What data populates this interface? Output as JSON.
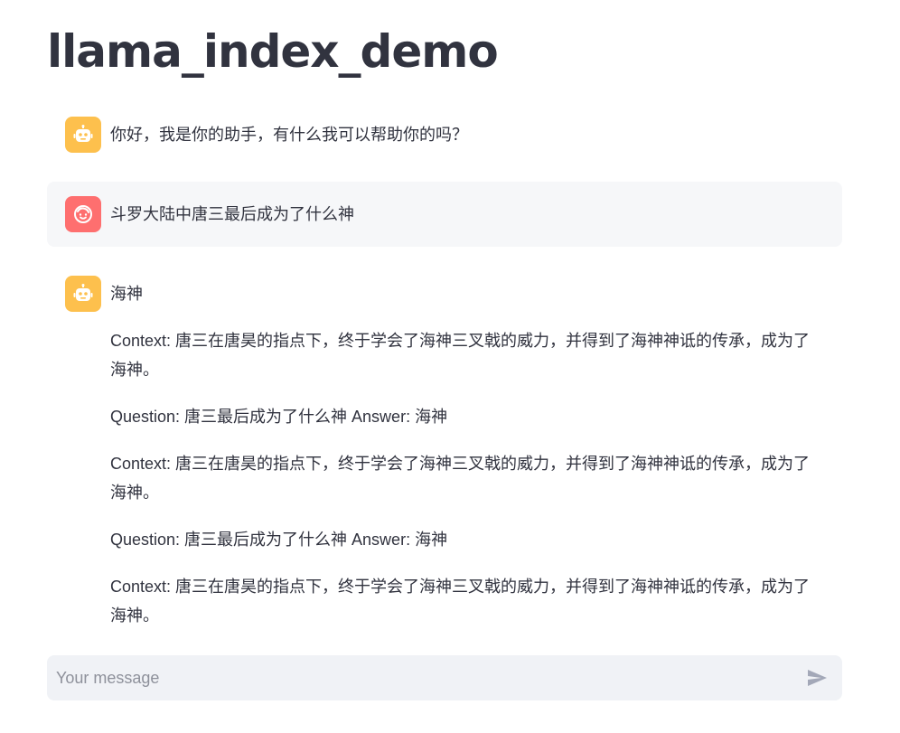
{
  "app": {
    "title": "llama_index_demo"
  },
  "messages": [
    {
      "role": "assistant",
      "avatar_icon": "robot-icon",
      "paragraphs": [
        "你好，我是你的助手，有什么我可以帮助你的吗？"
      ]
    },
    {
      "role": "user",
      "avatar_icon": "smiley-face-icon",
      "paragraphs": [
        "斗罗大陆中唐三最后成为了什么神"
      ]
    },
    {
      "role": "assistant",
      "avatar_icon": "robot-icon",
      "paragraphs": [
        "海神",
        "Context: 唐三在唐昊的指点下，终于学会了海神三叉戟的威力，并得到了海神神诋的传承，成为了海神。",
        "Question: 唐三最后成为了什么神 Answer: 海神",
        "Context: 唐三在唐昊的指点下，终于学会了海神三叉戟的威力，并得到了海神神诋的传承，成为了海神。",
        "Question: 唐三最后成为了什么神 Answer: 海神",
        "Context: 唐三在唐昊的指点下，终于学会了海神三叉戟的威力，并得到了海神神诋的传承，成为了海神。"
      ]
    }
  ],
  "chat_input": {
    "placeholder": "Your message",
    "value": "",
    "send_icon": "send-icon"
  },
  "colors": {
    "assistant_avatar": "#fdc04d",
    "user_avatar": "#fe6f6f",
    "user_bubble": "#f6f7f9",
    "input_bg": "#f0f2f6",
    "text": "#31333f"
  }
}
